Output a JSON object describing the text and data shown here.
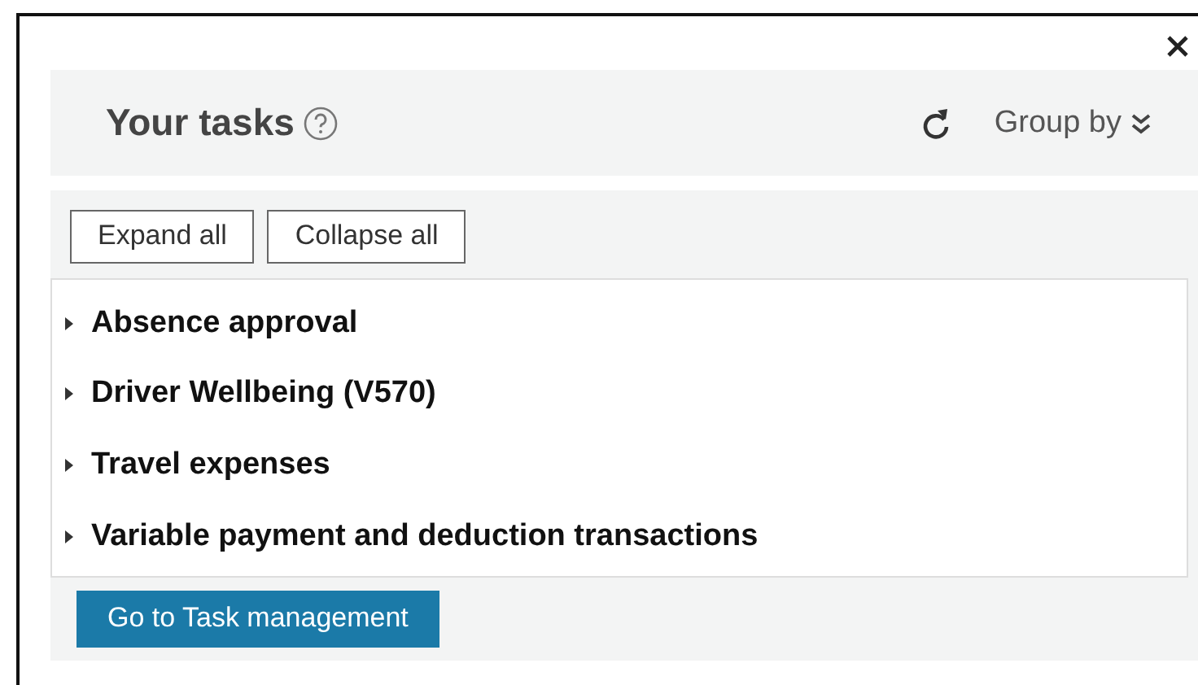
{
  "panel": {
    "title": "Your tasks",
    "group_by": "Group by"
  },
  "toolbar": {
    "buttons": [
      "Expand all",
      "Collapse all"
    ]
  },
  "tasks": [
    {
      "label": "Absence approval",
      "expanded": false
    },
    {
      "label": "Driver Wellbeing (V570)",
      "expanded": false
    },
    {
      "label": "Travel expenses",
      "expanded": false
    },
    {
      "label": "Variable payment and deduction transactions",
      "expanded": false
    }
  ],
  "footer": {
    "button": "Go to Task management"
  }
}
